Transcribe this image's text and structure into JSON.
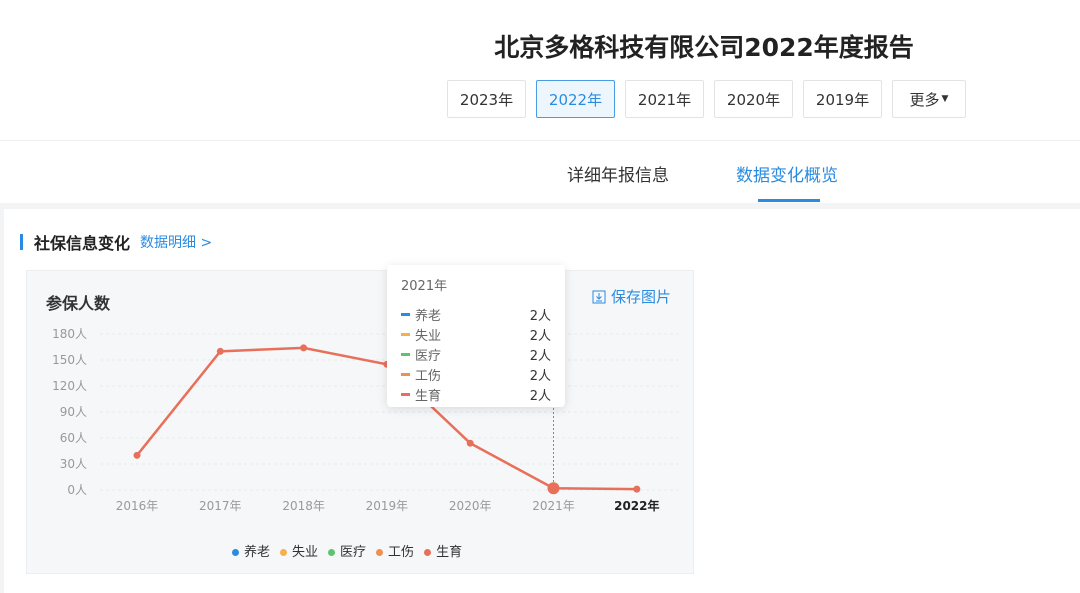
{
  "header": {
    "title": "北京多格科技有限公司2022年度报告",
    "years": [
      "2023年",
      "2022年",
      "2021年",
      "2020年",
      "2019年"
    ],
    "active_year": "2022年",
    "more": "更多"
  },
  "tabs": [
    "详细年报信息",
    "数据变化概览"
  ],
  "section": {
    "title": "社保信息变化",
    "link": "数据明细"
  },
  "card": {
    "title": "参保人数",
    "save": "保存图片"
  },
  "tooltip": {
    "title": "2021年",
    "rows": [
      {
        "name": "养老",
        "value": "2人"
      },
      {
        "name": "失业",
        "value": "2人"
      },
      {
        "name": "医疗",
        "value": "2人"
      },
      {
        "name": "工伤",
        "value": "2人"
      },
      {
        "name": "生育",
        "value": "2人"
      }
    ]
  },
  "chart_data": {
    "type": "line",
    "title": "参保人数",
    "categories": [
      "2016年",
      "2017年",
      "2018年",
      "2019年",
      "2020年",
      "2021年",
      "2022年"
    ],
    "yticks": [
      "0人",
      "30人",
      "60人",
      "90人",
      "120人",
      "150人",
      "180人"
    ],
    "ylim": [
      0,
      180
    ],
    "series": [
      {
        "name": "养老",
        "color": "#2a8be0",
        "values": null
      },
      {
        "name": "失业",
        "color": "#f5b04a",
        "values": null
      },
      {
        "name": "医疗",
        "color": "#5cc46a",
        "values": null
      },
      {
        "name": "工伤",
        "color": "#f38f4e",
        "values": null
      },
      {
        "name": "生育",
        "color": "#e8705a",
        "values": [
          40,
          160,
          164,
          145,
          54,
          2,
          1
        ]
      }
    ],
    "highlight": "2021年",
    "legend": "bottom"
  }
}
